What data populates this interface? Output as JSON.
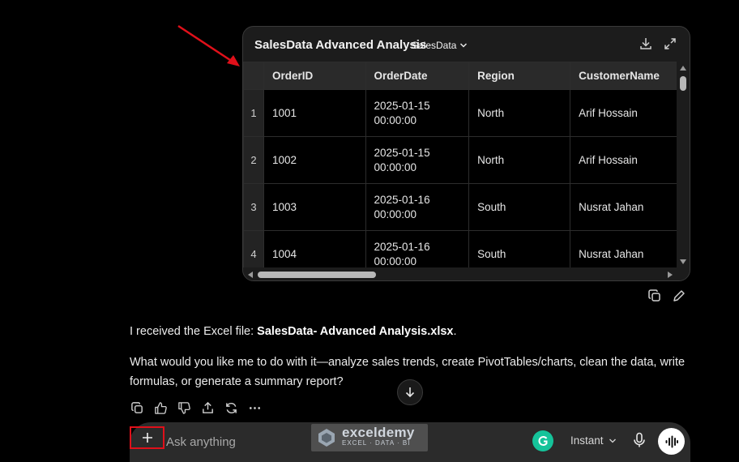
{
  "sheet": {
    "title": "SalesData Advanced Analysis",
    "tab": "SalesData",
    "columns": [
      "OrderID",
      "OrderDate",
      "Region",
      "CustomerName"
    ],
    "rows": [
      {
        "num": "1",
        "order_id": "1001",
        "order_date_1": "2025-01-15",
        "order_date_2": "00:00:00",
        "region": "North",
        "customer": "Arif Hossain"
      },
      {
        "num": "2",
        "order_id": "1002",
        "order_date_1": "2025-01-15",
        "order_date_2": "00:00:00",
        "region": "North",
        "customer": "Arif Hossain"
      },
      {
        "num": "3",
        "order_id": "1003",
        "order_date_1": "2025-01-16",
        "order_date_2": "00:00:00",
        "region": "South",
        "customer": "Nusrat Jahan"
      },
      {
        "num": "4",
        "order_id": "1004",
        "order_date_1": "2025-01-16",
        "order_date_2": "00:00:00",
        "region": "South",
        "customer": "Nusrat Jahan"
      }
    ],
    "icons": {
      "download": "download-icon",
      "expand": "expand-icon",
      "copy": "copy-icon",
      "edit": "pencil-icon"
    }
  },
  "message": {
    "line1_prefix": "I received the Excel file: ",
    "line1_file": "SalesData- Advanced Analysis.xlsx",
    "line1_suffix": ".",
    "para2": "What would you like me to do with it—analyze sales trends, create PivotTables/charts, clean the data, write formulas, or generate a summary report?"
  },
  "composer": {
    "placeholder": "Ask anything",
    "model": "Instant",
    "watermark_name": "exceldemy",
    "watermark_sub": "EXCEL · DATA · BI"
  },
  "colors": {
    "annotation": "#e0101a",
    "background": "#000000",
    "panel": "#1c1c1c",
    "grammarly": "#15c39a"
  }
}
